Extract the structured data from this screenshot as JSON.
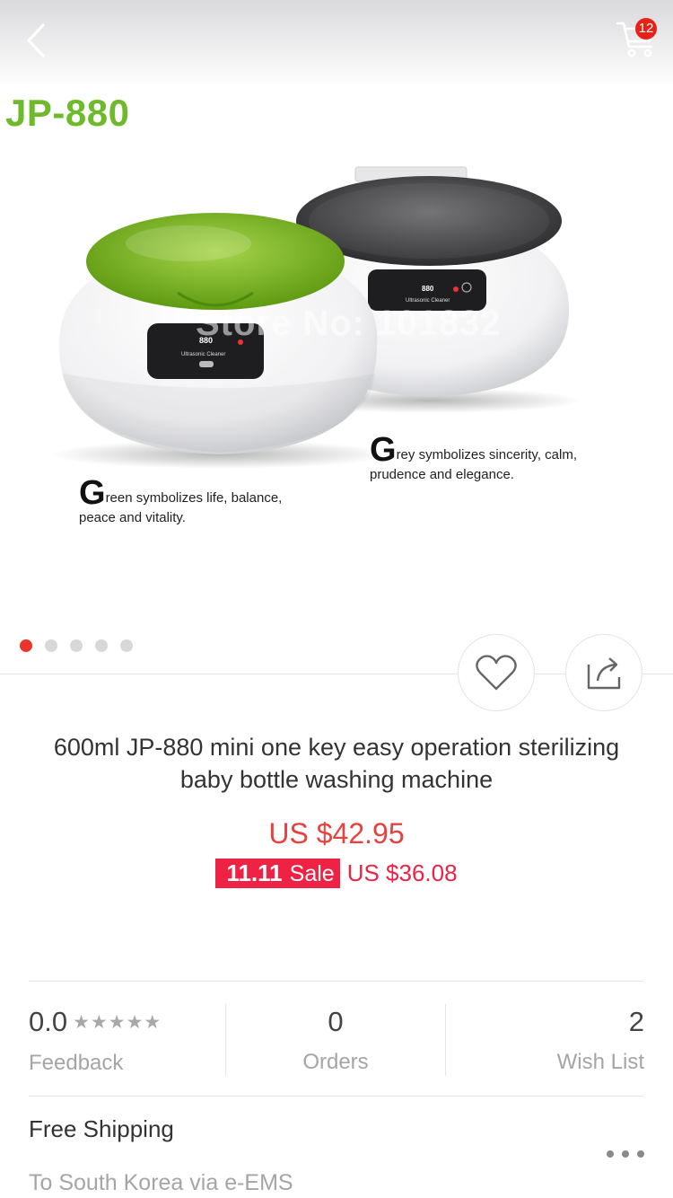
{
  "header": {
    "back_icon": "chevron-left-icon",
    "cart_icon": "cart-icon",
    "cart_count": "12"
  },
  "hero": {
    "model": "JP-880",
    "watermark": "Store No: 101832",
    "caption_grey_initial": "G",
    "caption_grey_rest": "rey symbolizes sincerity, calm, prudence and elegance.",
    "caption_green_initial": "G",
    "caption_green_rest": "reen symbolizes life, balance, peace and vitality.",
    "device_left_label": "880",
    "device_left_sub": "Ultrasonic Cleaner",
    "device_right_label": "880",
    "device_right_sub": "Ultrasonic Cleaner",
    "image_count": 5,
    "active_image": 1
  },
  "actions": {
    "wish_icon": "heart-icon",
    "share_icon": "share-icon"
  },
  "product": {
    "title": "600ml JP-880 mini one key easy operation sterilizing baby bottle washing machine",
    "original_price": "US $42.95",
    "sale_event": "11.11",
    "sale_word": "Sale",
    "sale_price": "US $36.08"
  },
  "stats": {
    "feedback_value": "0.0",
    "feedback_label": "Feedback",
    "feedback_stars": "★★★★★",
    "orders_value": "0",
    "orders_label": "Orders",
    "wishlist_value": "2",
    "wishlist_label": "Wish List"
  },
  "shipping": {
    "title": "Free Shipping",
    "subtitle": "To South Korea via e-EMS",
    "more_icon": "more-dots-icon"
  },
  "colors": {
    "accent_red": "#e64340",
    "sale_pink": "#ee2244",
    "brand_green": "#6fba2c",
    "dot_active": "#e8372a"
  }
}
